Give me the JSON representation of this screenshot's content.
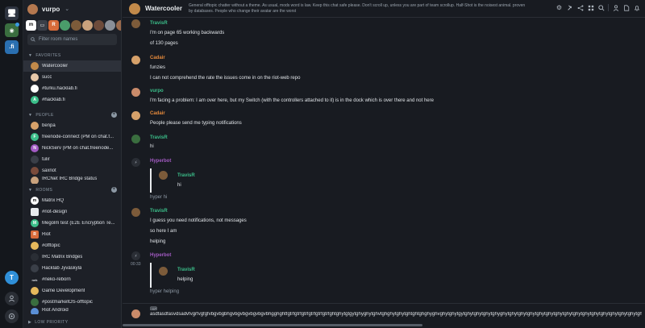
{
  "user": {
    "name": "vurpo"
  },
  "search": {
    "placeholder": "Filter room names"
  },
  "sections": {
    "favorites": "FAVORITES",
    "people": "PEOPLE",
    "rooms": "ROOMS",
    "low_priority": "LOW PRIORITY"
  },
  "favorites": [
    {
      "name": "Watercooler",
      "active": true
    },
    {
      "name": "succ"
    },
    {
      "name": "#turku.hacklab.fi"
    },
    {
      "name": "#hacklab.fi"
    }
  ],
  "people": [
    {
      "name": "benpa"
    },
    {
      "name": "freenode-connect (PM on chat.f..."
    },
    {
      "name": "NickServ (PM on chat.freenode..."
    },
    {
      "name": "tulir"
    },
    {
      "name": "saxnot"
    },
    {
      "name": "IRCNet IRC Bridge status"
    }
  ],
  "rooms": [
    {
      "name": "Matrix HQ"
    },
    {
      "name": "#riot-design"
    },
    {
      "name": "Megolm test (E2E Encryption Te..."
    },
    {
      "name": "Riot"
    },
    {
      "name": "#offtopic"
    },
    {
      "name": "IRC Matrix Bridges"
    },
    {
      "name": "Hacklab Jyväskylä"
    },
    {
      "name": "#neko-reborn"
    },
    {
      "name": "Game Development"
    },
    {
      "name": "#postmarketOS-offtopic"
    },
    {
      "name": "Riot Android"
    }
  ],
  "room_header": {
    "title": "Watercooler",
    "topic": "General offtopic chatter without a theme. As usual, mods word is law. Keep this chat safe please. Don't scroll up, unless you are part of team scrollup. Half-Shot is the noisest animal. proven by databases. People who change their avatar are the worst"
  },
  "messages": {
    "m1": {
      "sender": "TravisR",
      "lines": [
        "I'm on page 65 working backwards",
        "of 130 pages"
      ]
    },
    "m2": {
      "sender": "Cadair",
      "lines": [
        "funzies",
        "I can not comprehend the rate the issues come in on the riot-web repo"
      ]
    },
    "m3": {
      "sender": "vurpo",
      "lines": [
        "I'm facing a problem: I am over here, but my Switch (with the controllers attached to it) is in the dock which is over there and not here"
      ]
    },
    "m4": {
      "sender": "Cadair",
      "lines": [
        "People please send me typing notifications"
      ]
    },
    "m5": {
      "sender": "TravisR",
      "lines": [
        "hi"
      ]
    },
    "m6": {
      "sender": "Hyperbot",
      "quote_sender": "TravisR",
      "quote_text": "hi",
      "reply": "hyper hi"
    },
    "m7": {
      "sender": "TravisR",
      "lines": [
        "I guess you need notifications, not messages",
        "so here I am",
        "helping"
      ]
    },
    "m8": {
      "sender": "Hyperbot",
      "timestamp": "00:33",
      "quote_sender": "TravisR",
      "quote_text": "helping",
      "reply": "hyper helping"
    }
  },
  "composer": {
    "text": "asdfasdfasvdsadvfvgrfvgfgfvbgvbgbhgvbgvbgvbgvbgvbhgghghtfgtrfgtrfgtrfgtrfgtrfgtrfghtghytgtgytghyghytghvtghghytghytghtghtghghyghvghytghytgytghytghytghytghyghytghytghytghytghytghytghytghytghytghytghytghytghytghytghytghytghytghytghytgh"
  },
  "colors": {
    "accent": "#3bbf8a",
    "cadair": "#e58a3c",
    "hyperbot": "#a35bc4",
    "vurpo": "#3bbf8a"
  }
}
